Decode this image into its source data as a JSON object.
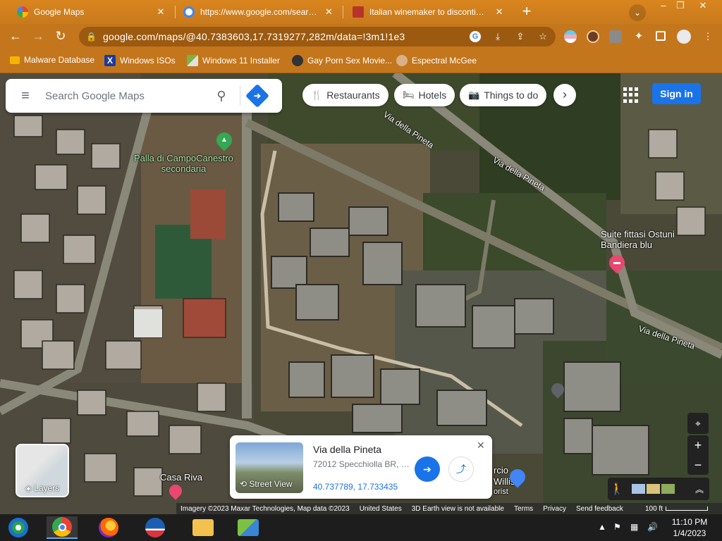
{
  "tabs": [
    {
      "title": "Google Maps",
      "active": true,
      "favicon": "google-maps-favicon",
      "color": "#34a853"
    },
    {
      "title": "https://www.google.com/search?",
      "active": false,
      "favicon": "google-favicon",
      "color": "#ffffff"
    },
    {
      "title": "Italian winemaker to discontinue",
      "active": false,
      "favicon": "news-favicon",
      "color": "#d44638"
    }
  ],
  "tab_close_glyph": "✕",
  "new_tab_glyph": "+",
  "tab_search_glyph": "⌄",
  "window_controls": {
    "minimize": "–",
    "restore": "❐",
    "close": "✕"
  },
  "toolbar": {
    "back": "←",
    "forward": "→",
    "reload": "↻",
    "url": "google.com/maps/@40.7383603,17.7319277,282m/data=!3m1!1e3",
    "lock_glyph": "🔒"
  },
  "bookmarks": [
    {
      "label": "Malware Database",
      "icon": "folder-icon"
    },
    {
      "label": "Windows ISOs",
      "icon": "x-icon"
    },
    {
      "label": "Windows 11 Installer",
      "icon": "image-icon"
    },
    {
      "label": "Gay Porn Sex Movie...",
      "icon": "globe-icon"
    },
    {
      "label": "Espectral McGee",
      "icon": "avatar-icon"
    }
  ],
  "maps": {
    "search_placeholder": "Search Google Maps",
    "chips": [
      {
        "label": "Restaurants",
        "icon": "fork-knife-icon"
      },
      {
        "label": "Hotels",
        "icon": "bed-icon"
      },
      {
        "label": "Things to do",
        "icon": "camera-icon"
      }
    ],
    "chip_next": "›",
    "sign_in": "Sign in",
    "labels": {
      "palla": "Palla di CampoCanestro\nsecondaria",
      "suite": "Suite fittasi Ostuni\nBandiera blu",
      "casa_riva": "Casa Riva",
      "marcio": "rcio",
      "willis": "Willis",
      "orist": "orist"
    },
    "road_names": [
      "Via della Pineta",
      "Via della Pineta",
      "Via della Pineta"
    ],
    "layers": "Layers",
    "infocard": {
      "name": "Via della Pineta",
      "address": "72012 Specchiolla BR, It...",
      "coords": "40.737789, 17.733435",
      "street_view": "Street View",
      "close": "✕"
    },
    "controls": {
      "locate": "⌖",
      "zoom_in": "+",
      "zoom_out": "−",
      "expand": "︽"
    },
    "attribution": {
      "imagery": "Imagery ©2023 Maxar Technologies, Map data ©2023",
      "country": "United States",
      "earth": "3D Earth view is not available",
      "terms": "Terms",
      "privacy": "Privacy",
      "feedback": "Send feedback",
      "scale": "100 ft"
    }
  },
  "taskbar": {
    "time": "11:10 PM",
    "date": "1/4/2023",
    "apps": [
      "windows-media-center-icon",
      "chrome-icon",
      "firefox-icon",
      "obama-logo-icon",
      "file-explorer-icon",
      "network-icon"
    ]
  },
  "colors": {
    "chrome_accent": "#c4761c",
    "maps_blue": "#1a73e8",
    "hotel_pin": "#e8486f",
    "attraction_pin": "#34a853"
  }
}
